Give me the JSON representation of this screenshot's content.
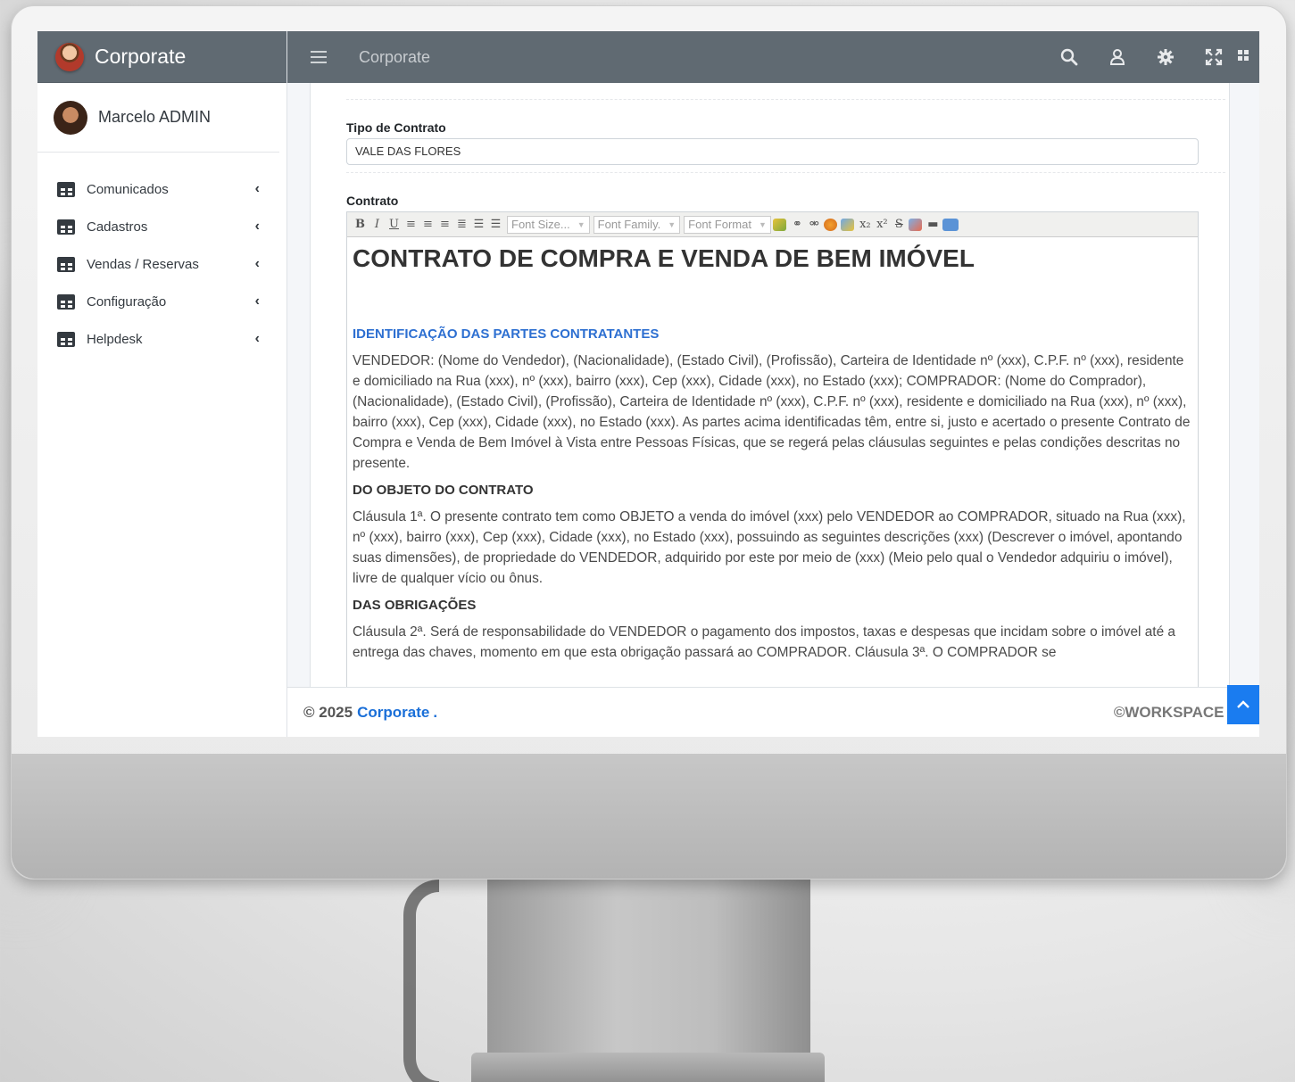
{
  "sidebar": {
    "brand": "Corporate",
    "user": "Marcelo ADMIN",
    "items": [
      {
        "label": "Comunicados"
      },
      {
        "label": "Cadastros"
      },
      {
        "label": "Vendas / Reservas"
      },
      {
        "label": "Configuração"
      },
      {
        "label": "Helpdesk"
      }
    ]
  },
  "navbar": {
    "title": "Corporate",
    "icons": [
      "search-icon",
      "user-icon",
      "gear-icon",
      "expand-icon",
      "grid-icon"
    ]
  },
  "form": {
    "tipo_label": "Tipo de Contrato",
    "tipo_value": "VALE DAS FLORES",
    "contrato_label": "Contrato"
  },
  "editor_toolbar": {
    "bold": "B",
    "italic": "I",
    "underline": "U",
    "font_size": "Font Size...",
    "font_family": "Font Family.",
    "font_format": "Font Format"
  },
  "document": {
    "title": "CONTRATO DE COMPRA E VENDA DE BEM IMÓVEL",
    "section1_heading": "IDENTIFICAÇÃO DAS PARTES CONTRATANTES",
    "section1_text": "VENDEDOR: (Nome do Vendedor), (Nacionalidade), (Estado Civil), (Profissão), Carteira de Identidade nº (xxx), C.P.F. nº (xxx), residente e domiciliado na Rua (xxx), nº (xxx), bairro (xxx), Cep (xxx), Cidade (xxx), no Estado (xxx); COMPRADOR: (Nome do Comprador), (Nacionalidade), (Estado Civil), (Profissão), Carteira de Identidade nº (xxx), C.P.F. nº (xxx), residente e domiciliado na Rua (xxx), nº (xxx), bairro (xxx), Cep (xxx), Cidade (xxx), no Estado (xxx). As partes acima identificadas têm, entre si, justo e acertado o presente Contrato de Compra e Venda de Bem Imóvel à Vista entre Pessoas Físicas, que se regerá pelas cláusulas seguintes e pelas condições descritas no presente.",
    "section2_heading": "DO OBJETO DO CONTRATO",
    "section2_text": "Cláusula 1ª. O presente contrato tem como OBJETO a venda do imóvel (xxx) pelo VENDEDOR ao COMPRADOR, situado na Rua (xxx), nº (xxx), bairro (xxx), Cep (xxx), Cidade (xxx), no Estado (xxx), possuindo as seguintes descrições (xxx) (Descrever o imóvel, apontando suas dimensões), de propriedade do VENDEDOR, adquirido por este por meio de (xxx) (Meio pelo qual o Vendedor adquiriu o imóvel), livre de qualquer vício ou ônus.",
    "section3_heading": "DAS OBRIGAÇÕES",
    "section3_text": "Cláusula 2ª. Será de responsabilidade do VENDEDOR o pagamento dos impostos, taxas e despesas que incidam sobre o imóvel até a entrega das chaves, momento em que esta obrigação passará ao COMPRADOR. Cláusula 3ª. O COMPRADOR se"
  },
  "footer": {
    "copyright": "© 2025",
    "brand": "Corporate",
    "dot": ".",
    "right": "©WORKSPACE Se"
  },
  "colors": {
    "navbar": "#606a72",
    "accent": "#1a7cf0",
    "heading_blue": "#2d6fd1"
  }
}
